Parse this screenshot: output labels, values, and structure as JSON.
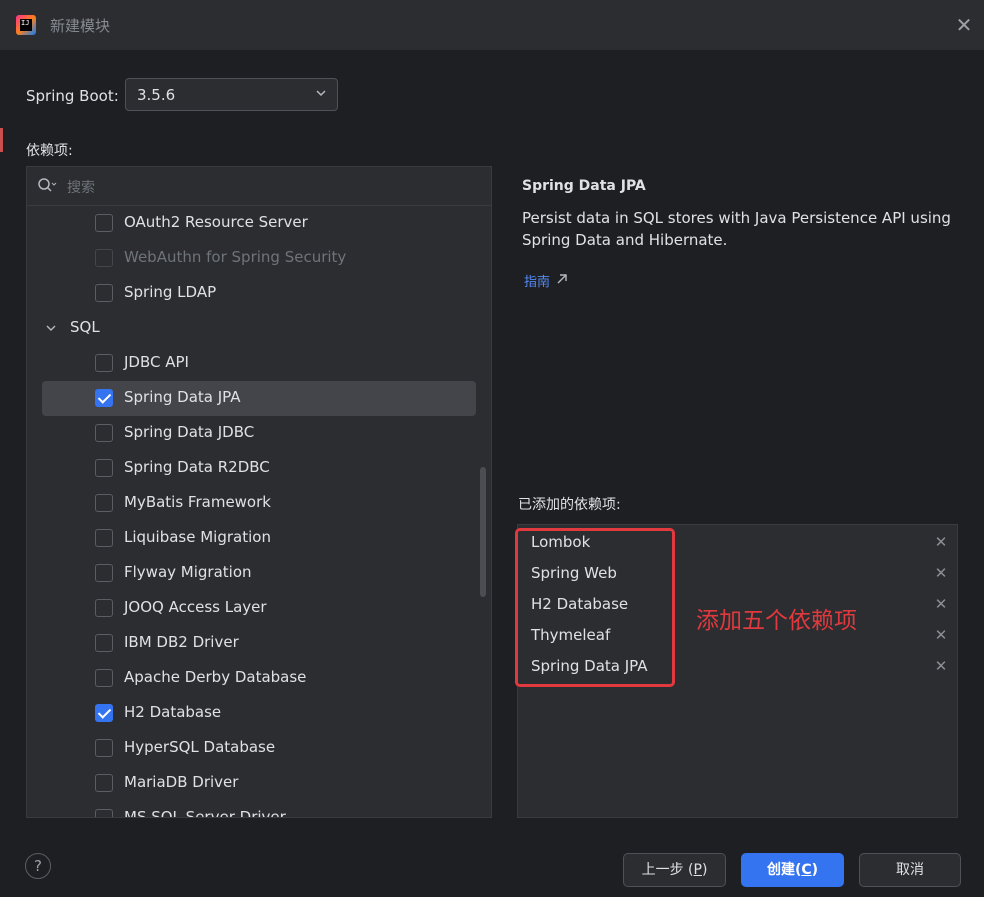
{
  "window": {
    "title": "新建模块"
  },
  "spring_boot": {
    "label": "Spring Boot:",
    "version": "3.5.6"
  },
  "dependencies": {
    "label": "依赖项:",
    "search_placeholder": "搜索",
    "items": [
      {
        "label": "OAuth2 Resource Server",
        "checked": false
      },
      {
        "label": "WebAuthn for Spring Security",
        "checked": false,
        "disabled": true
      },
      {
        "label": "Spring LDAP",
        "checked": false
      },
      {
        "group": "SQL"
      },
      {
        "label": "JDBC API",
        "checked": false
      },
      {
        "label": "Spring Data JPA",
        "checked": true,
        "selected": true
      },
      {
        "label": "Spring Data JDBC",
        "checked": false
      },
      {
        "label": "Spring Data R2DBC",
        "checked": false
      },
      {
        "label": "MyBatis Framework",
        "checked": false
      },
      {
        "label": "Liquibase Migration",
        "checked": false
      },
      {
        "label": "Flyway Migration",
        "checked": false
      },
      {
        "label": "JOOQ Access Layer",
        "checked": false
      },
      {
        "label": "IBM DB2 Driver",
        "checked": false
      },
      {
        "label": "Apache Derby Database",
        "checked": false
      },
      {
        "label": "H2 Database",
        "checked": true
      },
      {
        "label": "HyperSQL Database",
        "checked": false
      },
      {
        "label": "MariaDB Driver",
        "checked": false
      },
      {
        "label": "MS SQL Server Driver",
        "checked": false
      }
    ]
  },
  "detail": {
    "title": "Spring Data JPA",
    "description": "Persist data in SQL stores with Java Persistence API using Spring Data and Hibernate.",
    "guide_link": "指南"
  },
  "added": {
    "label": "已添加的依赖项:",
    "items": [
      "Lombok",
      "Spring Web",
      "H2 Database",
      "Thymeleaf",
      "Spring Data JPA"
    ]
  },
  "annotation": "添加五个依赖项",
  "footer": {
    "help": "?",
    "prev": {
      "text": "上一步 (",
      "key": "P",
      "end": ")"
    },
    "create": {
      "text": "创建(",
      "key": "C",
      "end": ")"
    },
    "cancel": "取消"
  },
  "colors": {
    "accent": "#3574f0",
    "annotation": "#e2393e",
    "link": "#548af7"
  }
}
